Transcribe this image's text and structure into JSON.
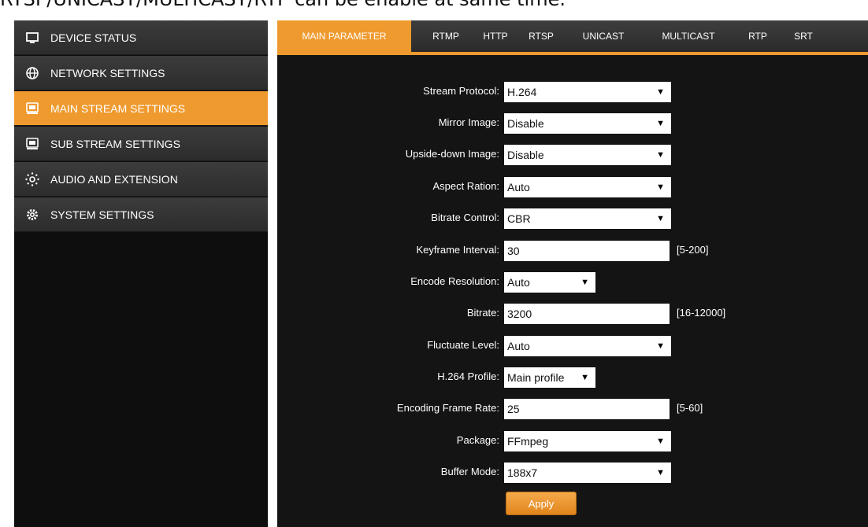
{
  "caption": "RTSP/UNICAST/MULTICAST/RTP can be enable at same time.",
  "colors": {
    "accent": "#ef9a2e",
    "sidebar_bg": "#2c2c2c",
    "panel_bg": "#141414"
  },
  "sidebar": {
    "items": [
      {
        "label": "DEVICE STATUS",
        "icon": "monitor-icon",
        "active": false
      },
      {
        "label": "NETWORK SETTINGS",
        "icon": "globe-icon",
        "active": false
      },
      {
        "label": "MAIN STREAM SETTINGS",
        "icon": "video-icon",
        "active": true
      },
      {
        "label": "SUB STREAM SETTINGS",
        "icon": "video-icon",
        "active": false
      },
      {
        "label": "AUDIO AND EXTENSION",
        "icon": "audio-icon",
        "active": false
      },
      {
        "label": "SYSTEM SETTINGS",
        "icon": "gear-icon",
        "active": false
      }
    ]
  },
  "tabs": [
    "MAIN PARAMETER",
    "RTMP",
    "HTTP",
    "RTSP",
    "UNICAST",
    "MULTICAST",
    "RTP",
    "SRT"
  ],
  "form": {
    "stream_protocol": {
      "label": "Stream Protocol:",
      "value": "H.264"
    },
    "mirror_image": {
      "label": "Mirror Image:",
      "value": "Disable"
    },
    "upside_down_image": {
      "label": "Upside-down Image:",
      "value": "Disable"
    },
    "aspect_ration": {
      "label": "Aspect Ration:",
      "value": "Auto"
    },
    "bitrate_control": {
      "label": "Bitrate Control:",
      "value": "CBR"
    },
    "keyframe_interval": {
      "label": "Keyframe Interval:",
      "value": "30",
      "hint": "[5-200]"
    },
    "encode_resolution": {
      "label": "Encode Resolution:",
      "value": "Auto"
    },
    "bitrate": {
      "label": "Bitrate:",
      "value": "3200",
      "hint": "[16-12000]"
    },
    "fluctuate_level": {
      "label": "Fluctuate Level:",
      "value": "Auto"
    },
    "h264_profile": {
      "label": "H.264 Profile:",
      "value": "Main profile"
    },
    "encoding_frame_rate": {
      "label": "Encoding Frame Rate:",
      "value": "25",
      "hint": "[5-60]"
    },
    "package": {
      "label": "Package:",
      "value": "FFmpeg"
    },
    "buffer_mode": {
      "label": "Buffer Mode:",
      "value": "188x7"
    }
  },
  "apply_label": "Apply",
  "dropdown_arrow": "▼"
}
